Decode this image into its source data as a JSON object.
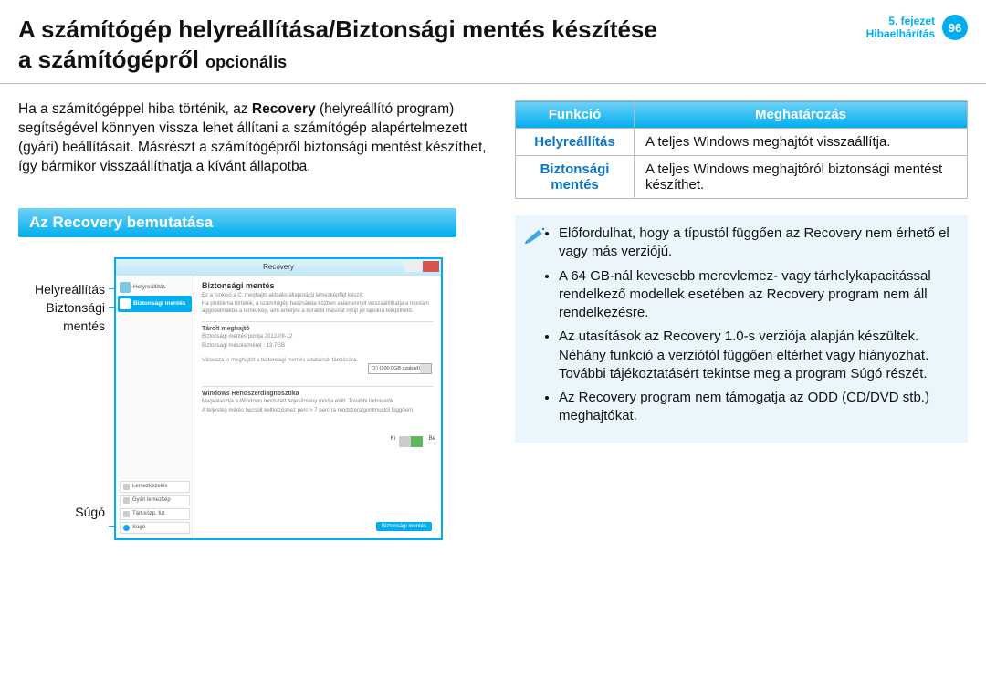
{
  "header": {
    "title_line1": "A számítógép helyreállítása/Biztonsági mentés készítése",
    "title_line2": "a számítógépről",
    "optional": "opcionális",
    "chapter_line1": "5. fejezet",
    "chapter_line2": "Hibaelhárítás",
    "page_number": "96"
  },
  "intro": {
    "p1_a": "Ha a számítógéppel hiba történik, az ",
    "p1_bold": "Recovery",
    "p1_b": " (helyreállító program) segítségével könnyen vissza lehet állítani a számítógép alapértelmezett (gyári) beállításait. Másrészt a számítógépről biztonsági mentést készíthet, így bármikor visszaállíthatja a kívánt állapotba."
  },
  "section_title": "Az Recovery bemutatása",
  "callouts": {
    "recovery": "Helyreállítás",
    "backup_l1": "Biztonsági",
    "backup_l2": "mentés",
    "help": "Súgó"
  },
  "screenshot": {
    "window_title": "Recovery",
    "side_recovery": "Helyreállítás",
    "side_backup": "Biztonsági mentés",
    "bottom1": "Lemezkezelés",
    "bottom2": "Gyári lemezkép",
    "bottom3": "Tárt.közp. fut.",
    "bottom_help": "Súgó",
    "main_heading": "Biztonsági mentés",
    "desc1": "Ez a funkció a C: meghajtó aktuális állapotáról lemezképfájt készít.",
    "desc2": "Ha probléma történik, a számítógép használata közben valamennyit visszaállíthatja a mostani aggodalmakba a lemezkép, ami amelyre a korábbi másolat nyújt jól lapokra telepíthető.",
    "sub1": "Tárolt meghajtó",
    "line1": "Biztonsági mentés pontja 2012-09-12",
    "line2": "Biztonsági mésolatméret : 13.7GB",
    "line3": "Válassza ki meghajtót a biztonsági mentés adatainak tárolására.",
    "dd": "D:\\ (200.0GB szabad)",
    "sub2": "Windows Rendszerdiagnosztika",
    "line4": "Magválasztja a Windows rendszert teljesítmény módja előtt. További tudnivalók.",
    "line5": "A teljestég mérés becsült keltkezéshez perc > 7 perc (a rendszeralgoritmustól függően)",
    "toggle_off": "Ki",
    "toggle_on": "Be",
    "button": "Biztonsági mentés"
  },
  "table": {
    "h1": "Funkció",
    "h2": "Meghatározás",
    "r1c1": "Helyreállítás",
    "r1c2": "A teljes Windows meghajtót visszaállítja.",
    "r2c1": "Biztonsági mentés",
    "r2c2": "A teljes Windows meghajtóról biztonsági mentést készíthet."
  },
  "notes": {
    "n1": "Előfordulhat, hogy a típustól függően az Recovery nem érhető el vagy más verziójú.",
    "n2": "A 64 GB-nál kevesebb merevlemez- vagy tárhelykapacitással rendelkező modellek esetében az Recovery program nem áll rendelkezésre.",
    "n3": "Az utasítások az Recovery 1.0-s verziója alapján készültek. Néhány funkció a verziótól függően eltérhet vagy hiányozhat. További tájékoztatásért tekintse meg a program Súgó részét.",
    "n4": "Az Recovery program nem támogatja az ODD (CD/DVD stb.) meghajtókat."
  }
}
